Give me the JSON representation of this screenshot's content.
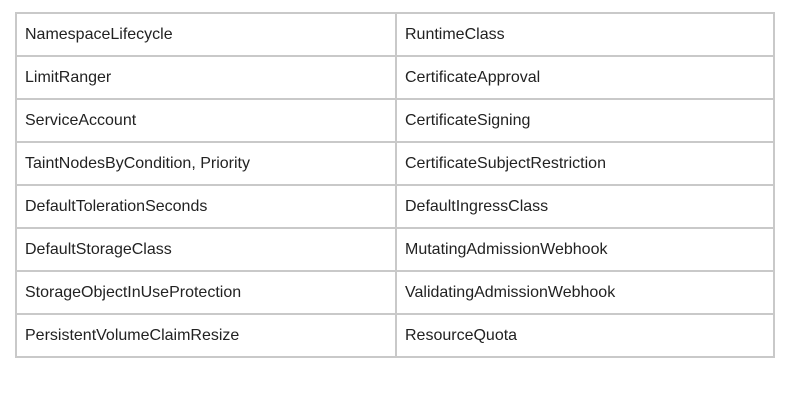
{
  "table": {
    "rows": [
      [
        "NamespaceLifecycle",
        "RuntimeClass"
      ],
      [
        "LimitRanger",
        "CertificateApproval"
      ],
      [
        "ServiceAccount",
        "CertificateSigning"
      ],
      [
        "TaintNodesByCondition, Priority",
        "CertificateSubjectRestriction"
      ],
      [
        "DefaultTolerationSeconds",
        "DefaultIngressClass"
      ],
      [
        "DefaultStorageClass",
        "MutatingAdmissionWebhook"
      ],
      [
        "StorageObjectInUseProtection",
        "ValidatingAdmissionWebhook"
      ],
      [
        "PersistentVolumeClaimResize",
        "ResourceQuota"
      ]
    ]
  }
}
